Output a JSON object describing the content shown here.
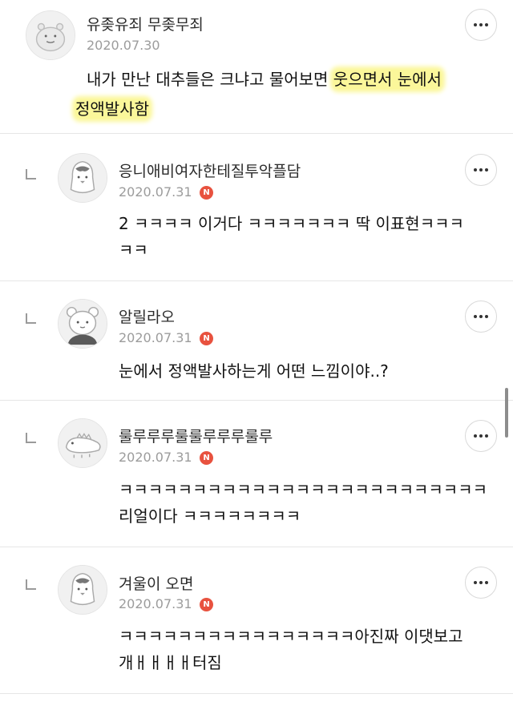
{
  "comments": [
    {
      "nickname": "유좆유죄 무좆무죄",
      "date": "2020.07.30",
      "line1_plain": "내가 만난 대추들은 크냐고 물어보면 ",
      "line1_highlight": "웃으면서 눈에서",
      "line2_highlight": "정액발사함",
      "new_badge": ""
    },
    {
      "nickname": "응니애비여자한테질투악플담",
      "date": "2020.07.31",
      "line1": "2 ㅋㅋㅋㅋ 이거다 ㅋㅋㅋㅋㅋㅋㅋ 딱 이표현ㅋㅋㅋ",
      "line2": "ㅋㅋ",
      "new_badge": "N"
    },
    {
      "nickname": "알릴라오",
      "date": "2020.07.31",
      "line1": "눈에서 정액발사하는게 어떤 느낌이야..?",
      "new_badge": "N"
    },
    {
      "nickname": "룰루루루룰룰루루루룰루",
      "date": "2020.07.31",
      "line1": "ㅋㅋㅋㅋㅋㅋㅋㅋㅋㅋㅋㅋㅋㅋㅋㅋㅋㅋㅋㅋㅋㅋㅋㅋㅋ",
      "line2": "리얼이다 ㅋㅋㅋㅋㅋㅋㅋㅋ",
      "new_badge": "N"
    },
    {
      "nickname": "겨울이 오면",
      "date": "2020.07.31",
      "line1": "ㅋㅋㅋㅋㅋㅋㅋㅋㅋㅋㅋㅋㅋㅋㅋㅋ아진짜 이댓보고",
      "line2": "개ㅐㅐㅐㅐ터짐",
      "new_badge": "N"
    }
  ],
  "icons": {
    "more": "more-options-icon",
    "reply": "reply-indent-icon",
    "new": "new-badge-icon"
  },
  "colors": {
    "highlight": "#fbf79a",
    "new_badge": "#e8523f",
    "date": "#9c9c9c"
  }
}
